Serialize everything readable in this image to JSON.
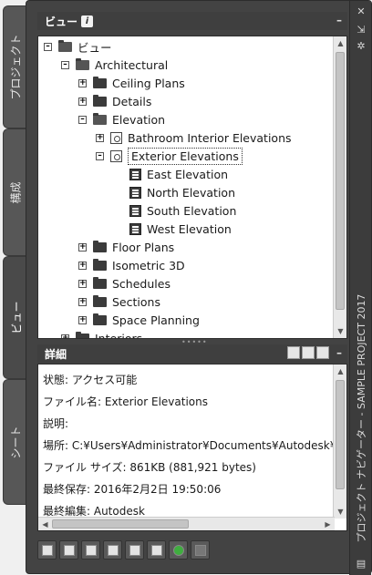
{
  "tabs": [
    "プロジェクト",
    "構成",
    "ビュー",
    "シート"
  ],
  "active_tab": "ビュー",
  "palette_title": "プロジェクト ナビゲーター - SAMPLE PROJECT 2017",
  "views_header": {
    "title": "ビュー",
    "info": "i",
    "minimize": "–"
  },
  "tree": [
    {
      "label": "ビュー",
      "toggle": "–",
      "icon": "folder-open",
      "level": 0
    },
    {
      "label": "Architectural",
      "toggle": "–",
      "icon": "folder-open",
      "level": 1
    },
    {
      "label": "Ceiling Plans",
      "toggle": "+",
      "icon": "folder",
      "level": 2
    },
    {
      "label": "Details",
      "toggle": "+",
      "icon": "folder",
      "level": 2
    },
    {
      "label": "Elevation",
      "toggle": "–",
      "icon": "folder-open",
      "level": 2
    },
    {
      "label": "Bathroom Interior Elevations",
      "toggle": "+",
      "icon": "view",
      "level": 3
    },
    {
      "label": "Exterior Elevations",
      "toggle": "–",
      "icon": "view",
      "level": 3,
      "selected": true
    },
    {
      "label": "East Elevation",
      "toggle": "",
      "icon": "elevation",
      "level": 4
    },
    {
      "label": "North Elevation",
      "toggle": "",
      "icon": "elevation",
      "level": 4
    },
    {
      "label": "South Elevation",
      "toggle": "",
      "icon": "elevation",
      "level": 4
    },
    {
      "label": "West Elevation",
      "toggle": "",
      "icon": "elevation",
      "level": 4
    },
    {
      "label": "Floor Plans",
      "toggle": "+",
      "icon": "folder",
      "level": 2
    },
    {
      "label": "Isometric 3D",
      "toggle": "+",
      "icon": "folder",
      "level": 2
    },
    {
      "label": "Schedules",
      "toggle": "+",
      "icon": "folder",
      "level": 2
    },
    {
      "label": "Sections",
      "toggle": "+",
      "icon": "folder",
      "level": 2
    },
    {
      "label": "Space Planning",
      "toggle": "+",
      "icon": "folder",
      "level": 2
    },
    {
      "label": "Interiors",
      "toggle": "+",
      "icon": "folder",
      "level": 1
    }
  ],
  "details_header": {
    "title": "詳細",
    "minimize": "–"
  },
  "details": [
    "状態: アクセス可能",
    "ファイル名: Exterior Elevations",
    "説明:",
    "場所: C:¥Users¥Administrator¥Documents¥Autodesk¥",
    "ファイル サイズ: 861KB (881,921 bytes)",
    "最終保存: 2016年2月2日  19:50:06",
    "最終編集: Autodesk"
  ],
  "side_icons": [
    "close-icon",
    "pin-icon",
    "settings-icon"
  ],
  "toolbar_buttons": [
    "new-view-icon",
    "open-view-icon",
    "view-properties-icon",
    "delete-icon",
    "select-icon",
    "sheet-icon",
    "refresh-icon",
    "disabled-icon"
  ]
}
